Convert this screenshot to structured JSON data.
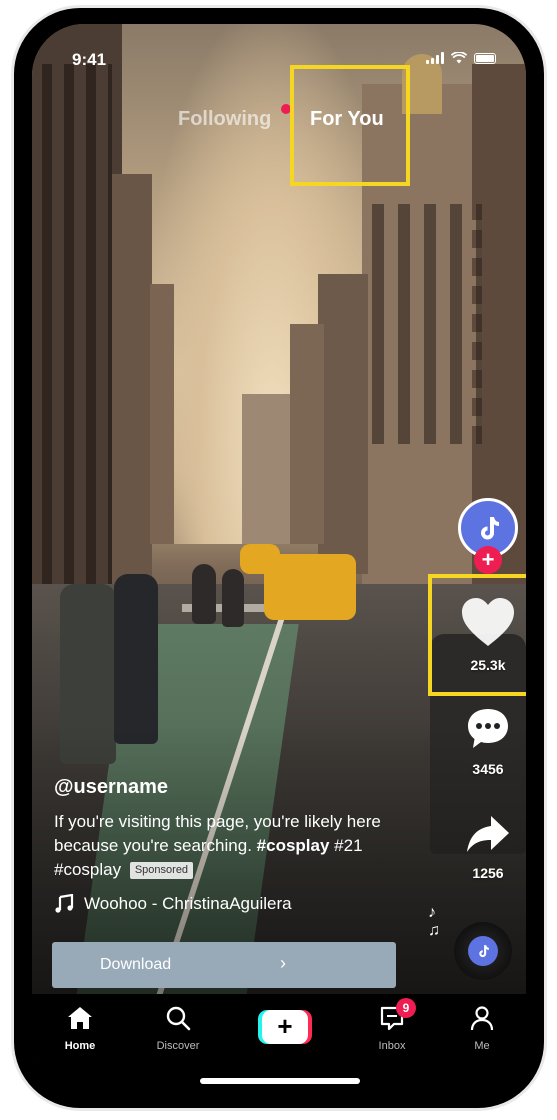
{
  "status_bar": {
    "time": "9:41"
  },
  "top_tabs": {
    "following": "Following",
    "for_you": "For You"
  },
  "rail": {
    "likes": "25.3k",
    "comments": "3456",
    "shares": "1256",
    "follow_symbol": "+"
  },
  "post": {
    "username": "@username",
    "caption_text": "If you're visiting this page, you're likely here because you're searching.",
    "hashtag_1": "#cosplay",
    "hashtag_2": "#21",
    "hashtag_3": "#cosplay",
    "sponsored": "Sponsored",
    "music": "Woohoo - ChristinaAguilera"
  },
  "download": {
    "label": "Download",
    "arrow": "›"
  },
  "bottom_nav": {
    "home": "Home",
    "discover": "Discover",
    "create_symbol": "+",
    "inbox": "Inbox",
    "inbox_badge": "9",
    "me": "Me"
  },
  "colors": {
    "accent_red": "#ee1d52",
    "highlight_yellow": "#f5d622",
    "avatar_blue": "#5d73e2",
    "download_bar": "#98a9b8"
  },
  "icons": [
    "heart-icon",
    "comment-icon",
    "share-icon",
    "music-note-icon",
    "home-icon",
    "search-icon",
    "create-icon",
    "inbox-icon",
    "profile-icon",
    "tiktok-logo-icon"
  ]
}
